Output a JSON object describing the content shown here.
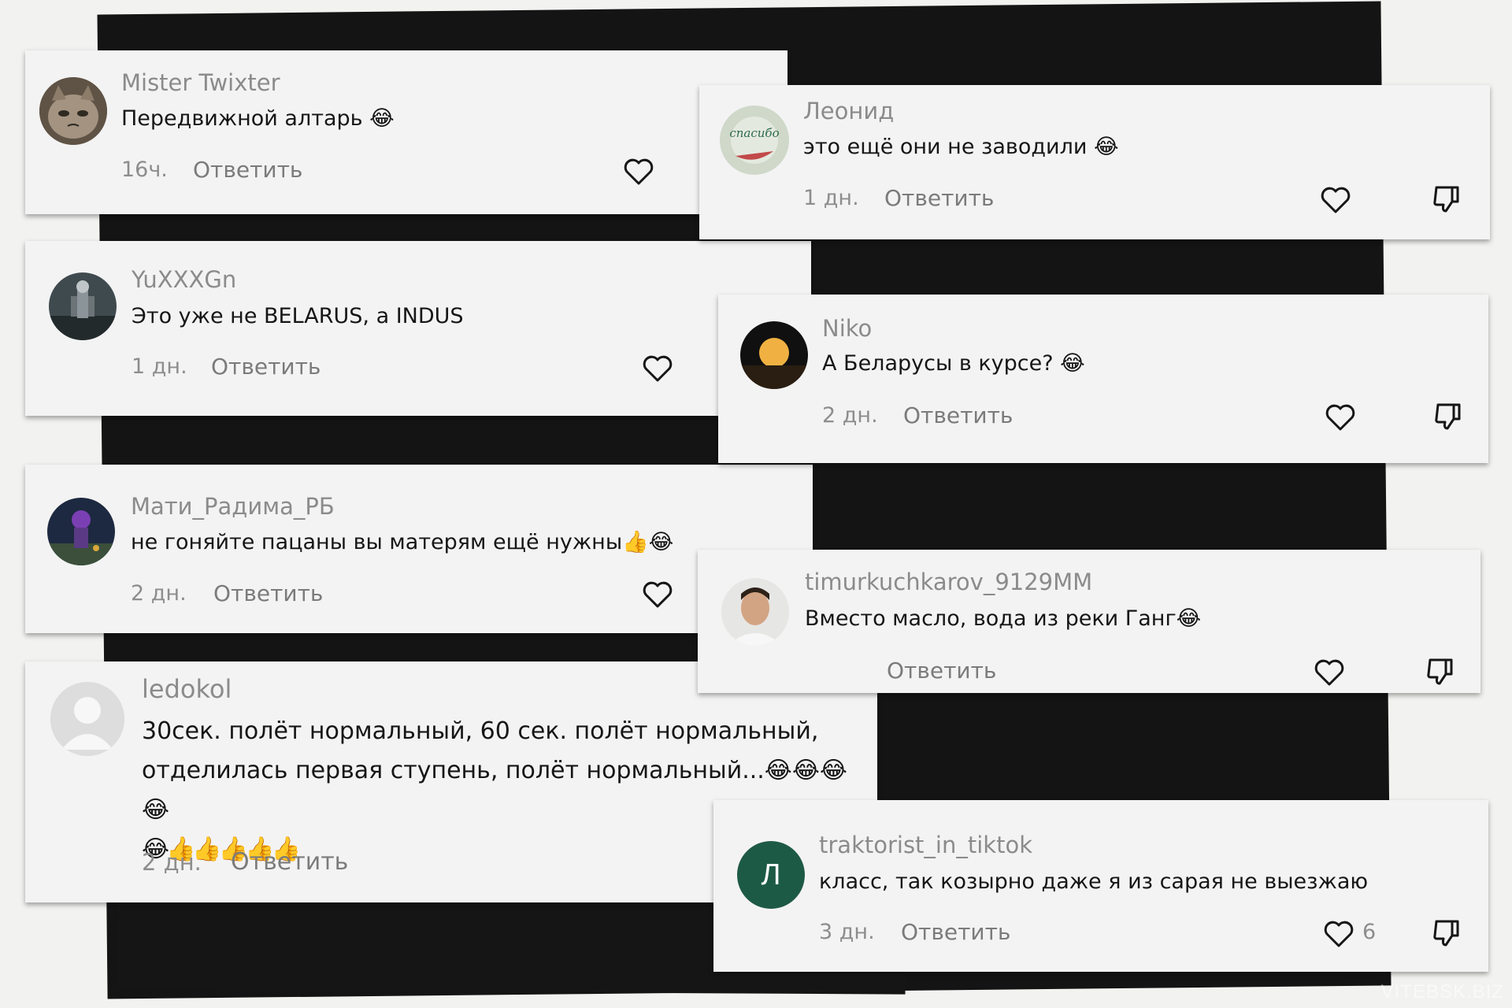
{
  "comments": [
    {
      "username": "Mister Twixter",
      "text": "Передвижной алтарь 😂",
      "time": "16ч.",
      "reply": "Ответить"
    },
    {
      "username": "Леонид",
      "text": "это ещё они не заводили 😂",
      "time": "1 дн.",
      "reply": "Ответить"
    },
    {
      "username": "YuXXXGn",
      "text": "Это уже не BELARUS, а INDUS",
      "time": "1 дн.",
      "reply": "Ответить"
    },
    {
      "username": "Niko",
      "text": "А Беларусы в курсе? 😂",
      "time": "2 дн.",
      "reply": "Ответить"
    },
    {
      "username": "Мати_Радима_РБ",
      "text": "не гоняйте пацаны вы матерям ещё нужны👍😂",
      "time": "2 дн.",
      "reply": "Ответить"
    },
    {
      "username": "timurkuchkarov_9129MM",
      "text": "Вместо масло, вода из реки Ганг😂",
      "reply": "Ответить"
    },
    {
      "username": "ledokol",
      "text_line1": "30сек. полёт нормальный, 60 сек. полёт нормальный,",
      "text_line2": "отделилась первая ступень, полёт нормальный...😂😂😂😂",
      "text_line3": "😂👍👍👍👍👍",
      "time": "2 дн.",
      "reply": "Ответить"
    },
    {
      "username": "traktorist_in_tiktok",
      "text": "класс, так козырно даже я из сарая не выезжаю",
      "time": "3 дн.",
      "reply": "Ответить",
      "likes": "6",
      "avatar_letter": "Л",
      "avatar_color": "#1d5a45"
    }
  ],
  "watermark": "VITEBSK.BIZ",
  "icons": {
    "like": "heart-outline-icon",
    "dislike": "thumbs-down-icon"
  }
}
